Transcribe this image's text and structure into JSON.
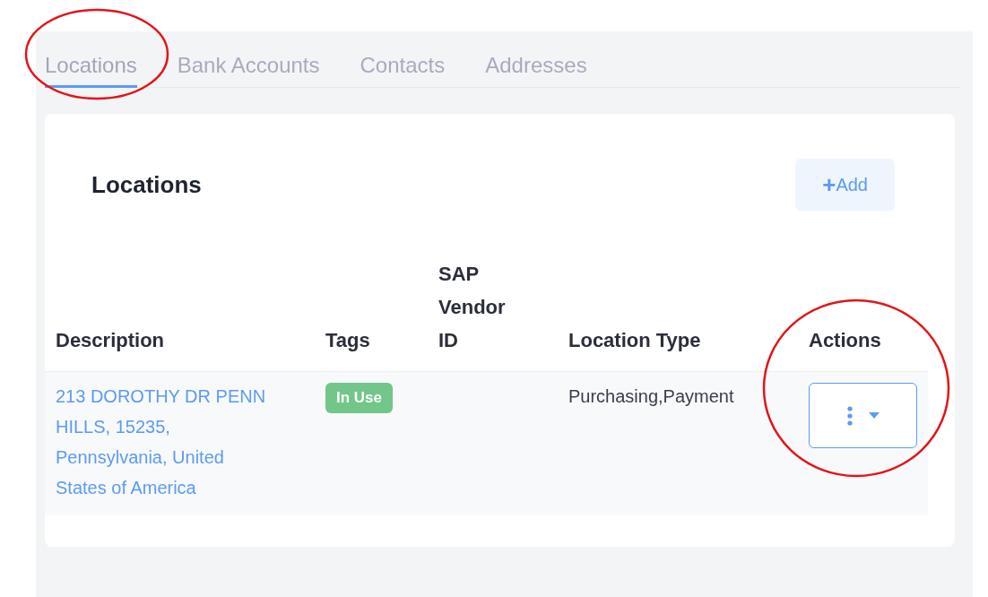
{
  "tabs": [
    {
      "label": "Locations",
      "selected": true
    },
    {
      "label": "Bank Accounts",
      "selected": false
    },
    {
      "label": "Contacts",
      "selected": false
    },
    {
      "label": "Addresses",
      "selected": false
    }
  ],
  "card": {
    "title": "Locations",
    "add_button": {
      "icon": "+",
      "label": "Add"
    }
  },
  "table": {
    "columns": [
      "Description",
      "Tags",
      "SAP Vendor ID",
      "Location Type",
      "Actions"
    ],
    "rows": [
      {
        "description": "213 DOROTHY DR PENN HILLS, 15235, Pennsylvania, United States of America",
        "tags": [
          {
            "label": "In Use",
            "color": "#72c689"
          }
        ],
        "location_type": "Purchasing,Payment"
      }
    ]
  }
}
